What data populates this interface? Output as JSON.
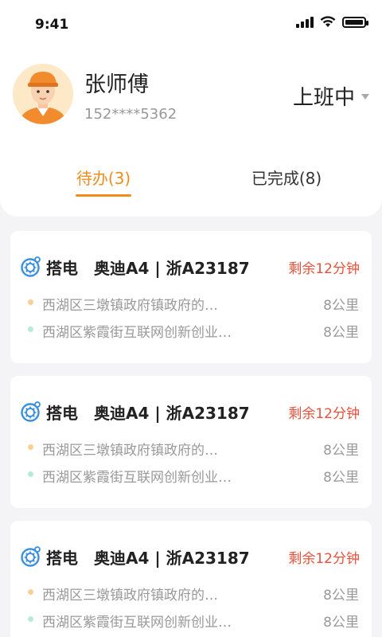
{
  "status_bar": {
    "time": "9:41"
  },
  "profile": {
    "name": "张师傅",
    "phone": "152****5362",
    "work_status": "上班中"
  },
  "tabs": [
    {
      "label": "待办(3)",
      "active": true
    },
    {
      "label": "已完成(8)",
      "active": false
    }
  ],
  "colors": {
    "accent": "#f08c1e",
    "warning": "#e8503a",
    "start_dot": "#f9cf95",
    "end_dot": "#b7ead8"
  },
  "orders": [
    {
      "service": "搭电",
      "car": "奥迪A4 | 浙A23187",
      "remaining": "剩余12分钟",
      "icon": "tire-icon",
      "from": {
        "address": "西湖区三墩镇政府镇政府的…",
        "distance": "8公里"
      },
      "to": {
        "address": "西湖区紫霞街互联网创新创业…",
        "distance": "8公里"
      }
    },
    {
      "service": "搭电",
      "car": "奥迪A4 | 浙A23187",
      "remaining": "剩余12分钟",
      "icon": "tire-icon",
      "from": {
        "address": "西湖区三墩镇政府镇政府的…",
        "distance": "8公里"
      },
      "to": {
        "address": "西湖区紫霞街互联网创新创业…",
        "distance": "8公里"
      }
    },
    {
      "service": "搭电",
      "car": "奥迪A4 | 浙A23187",
      "remaining": "剩余12分钟",
      "icon": "tire-icon",
      "from": {
        "address": "西湖区三墩镇政府镇政府的…",
        "distance": "8公里"
      },
      "to": {
        "address": "西湖区紫霞街互联网创新创业…",
        "distance": "8公里"
      }
    }
  ]
}
